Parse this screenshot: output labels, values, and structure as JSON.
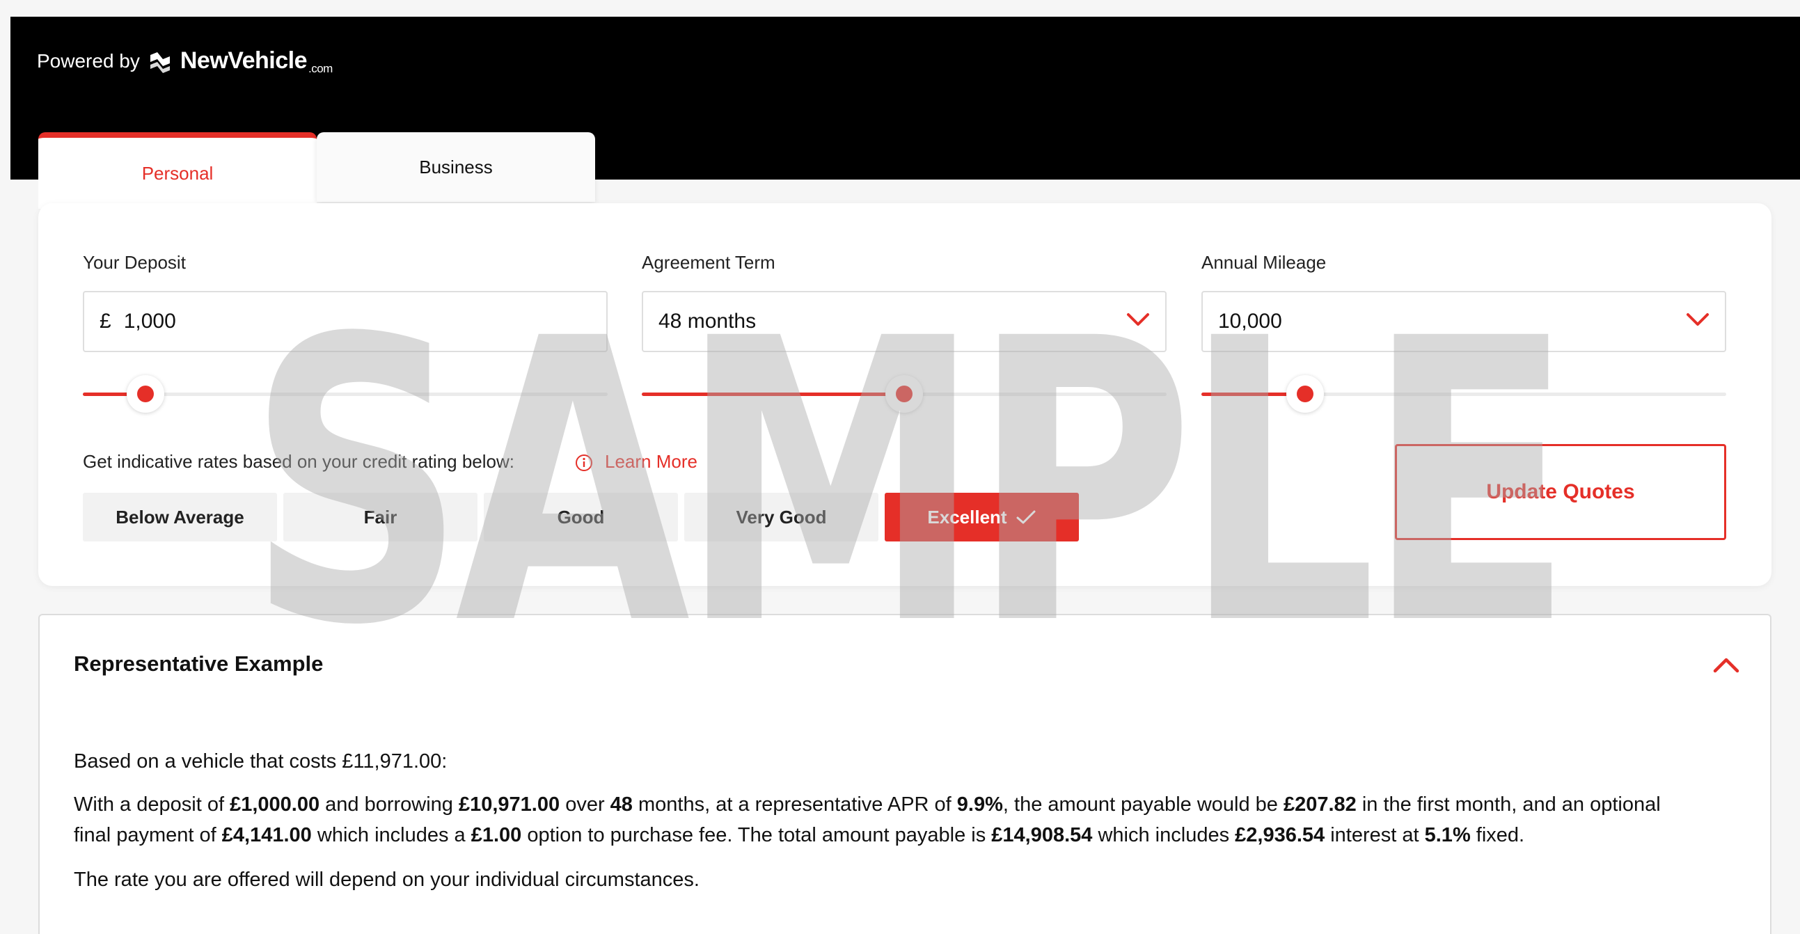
{
  "header": {
    "powered_by": "Powered by",
    "brand": "NewVehicle",
    "brand_tld": ".com"
  },
  "tabs": [
    {
      "label": "Personal",
      "active": true
    },
    {
      "label": "Business",
      "active": false
    }
  ],
  "form": {
    "deposit": {
      "label": "Your Deposit",
      "currency": "£",
      "value": "1,000",
      "slider_fraction": 0.12
    },
    "term": {
      "label": "Agreement Term",
      "value": "48 months",
      "slider_fraction": 0.5
    },
    "mileage": {
      "label": "Annual Mileage",
      "value": "10,000",
      "slider_fraction": 0.197
    }
  },
  "credit": {
    "prompt": "Get indicative rates based on your credit rating below:",
    "learn_more": "Learn More",
    "options": [
      "Below Average",
      "Fair",
      "Good",
      "Very Good",
      "Excellent"
    ],
    "selected": "Excellent"
  },
  "update_button": "Update Quotes",
  "representative": {
    "title": "Representative Example",
    "intro": "Based on a vehicle that costs £11,971.00:",
    "p1": {
      "t1": "With a deposit of ",
      "deposit": "£1,000.00",
      "t2": " and borrowing ",
      "borrowing": "£10,971.00",
      "t3": " over ",
      "months": "48",
      "t4": " months, at a representative APR of ",
      "apr": "9.9%",
      "t5": ", the amount payable would be ",
      "first_payment": "£207.82",
      "t6": " in the first month, and an optional"
    },
    "p2": {
      "t1": "final payment of ",
      "final_payment": "£4,141.00",
      "t2": " which includes a ",
      "option_fee": "£1.00",
      "t3": " option to purchase fee. The total amount payable is ",
      "total": "£14,908.54",
      "t4": " which includes ",
      "interest": "£2,936.54",
      "t5": " interest at ",
      "rate": "5.1%",
      "t6": " fixed."
    },
    "footer": "The rate you are offered will depend on your individual circumstances."
  },
  "watermark": "SAMPLE",
  "colors": {
    "accent": "#e52f28",
    "header_bg": "#000000",
    "page_bg": "#f6f6f6"
  }
}
